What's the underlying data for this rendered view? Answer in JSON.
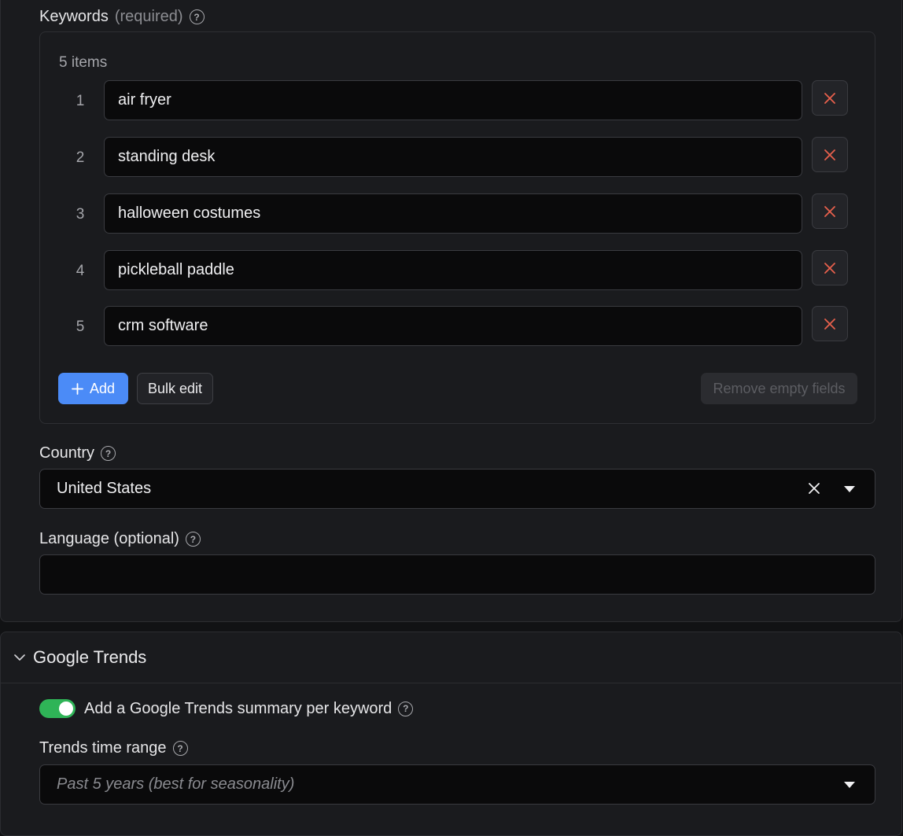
{
  "keywords": {
    "label": "Keywords",
    "required_note": "(required)",
    "count_text": "5 items",
    "items": [
      {
        "index": "1",
        "value": "air fryer"
      },
      {
        "index": "2",
        "value": "standing desk"
      },
      {
        "index": "3",
        "value": "halloween costumes"
      },
      {
        "index": "4",
        "value": "pickleball paddle"
      },
      {
        "index": "5",
        "value": "crm software"
      }
    ],
    "add_label": "Add",
    "bulk_edit_label": "Bulk edit",
    "remove_empty_label": "Remove empty fields"
  },
  "country": {
    "label": "Country",
    "value": "United States"
  },
  "language": {
    "label": "Language (optional)",
    "value": ""
  },
  "google_trends": {
    "section_title": "Google Trends",
    "toggle_label": "Add a Google Trends summary per keyword",
    "toggle_on": true,
    "time_range_label": "Trends time range",
    "time_range_placeholder": "Past 5 years (best for seasonality)"
  },
  "colors": {
    "accent": "#4b8bf7",
    "toggle_on": "#2fb457",
    "remove_icon": "#e8604c"
  },
  "icons": {
    "help": "question-circle-icon",
    "remove": "close-icon",
    "add": "plus-icon",
    "clear": "close-icon",
    "dropdown": "caret-down-icon",
    "collapse": "chevron-down-icon"
  }
}
